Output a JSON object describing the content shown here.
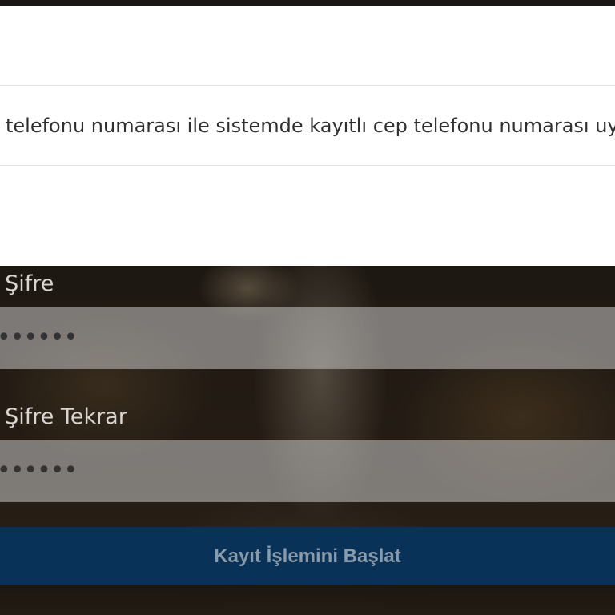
{
  "info": {
    "message": "telefonu numarası ile sistemde kayıtlı cep telefonu numarası uyuşmuyor"
  },
  "form": {
    "password_label": "i Şifre",
    "password_value": "••••••",
    "password_repeat_label": "i Şifre Tekrar",
    "password_repeat_value": "••••••",
    "submit_label": "Kayıt İşlemini Başlat"
  },
  "colors": {
    "panel_background": "#ffffff",
    "button_background": "#083258",
    "button_text": "#8a9aa8",
    "label_text": "#d9d6d2"
  }
}
